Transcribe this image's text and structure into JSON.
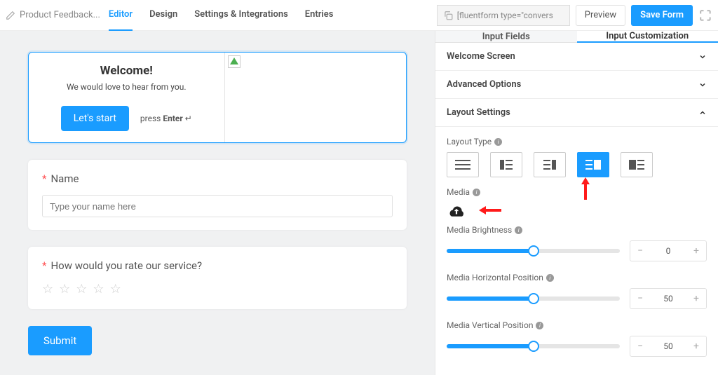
{
  "header": {
    "form_name": "Product Feedback...",
    "tabs": [
      "Editor",
      "Design",
      "Settings & Integrations",
      "Entries"
    ],
    "active_tab": 0,
    "shortcode": "[fluentform type=\"convers",
    "preview_label": "Preview",
    "save_label": "Save Form"
  },
  "canvas": {
    "welcome": {
      "title": "Welcome!",
      "subtitle": "We would love to hear from you.",
      "button": "Let's start",
      "hint_prefix": "press ",
      "hint_key": "Enter",
      "hint_glyph": "↵"
    },
    "q_name": {
      "label": "Name",
      "placeholder": "Type your name here"
    },
    "q_rating": {
      "label": "How would you rate our service?"
    },
    "submit_label": "Submit"
  },
  "sidebar": {
    "tabs": [
      "Input Fields",
      "Input Customization"
    ],
    "active_tab": 1,
    "sections": {
      "welcome": "Welcome Screen",
      "advanced": "Advanced Options",
      "layout": "Layout Settings"
    },
    "layout": {
      "type_label": "Layout Type",
      "active_index": 3,
      "media_label": "Media",
      "brightness_label": "Media Brightness",
      "brightness_value": 0,
      "brightness_pct": 50,
      "hpos_label": "Media Horizontal Position",
      "hpos_value": 50,
      "hpos_pct": 50,
      "vpos_label": "Media Vertical Position",
      "vpos_value": 50,
      "vpos_pct": 50
    }
  }
}
